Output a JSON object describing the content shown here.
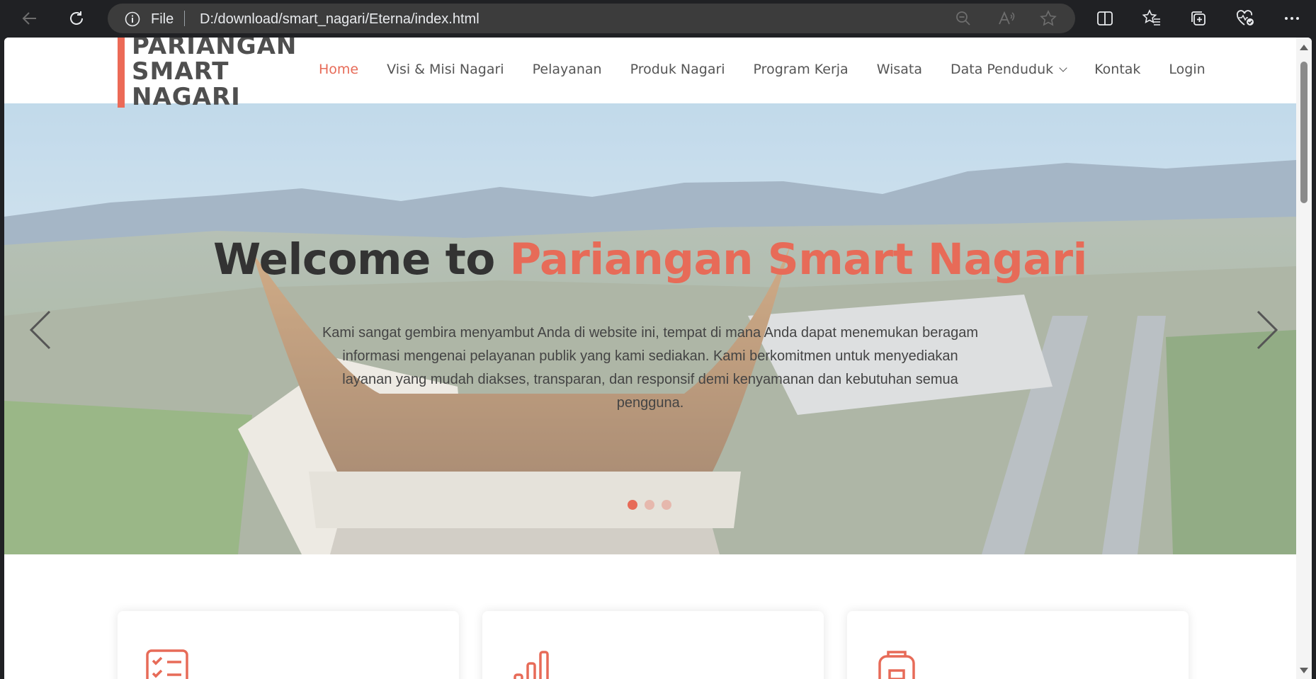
{
  "browser": {
    "scheme": "File",
    "url": "D:/download/smart_nagari/Eterna/index.html",
    "icons": [
      "back-icon",
      "refresh-icon",
      "info-icon",
      "zoom-out-icon",
      "read-aloud-icon",
      "star-icon",
      "split-screen-icon",
      "favorites-icon",
      "collections-icon",
      "browser-essentials-icon",
      "more-icon"
    ]
  },
  "site": {
    "logo_line1": "PARIANGAN",
    "logo_line2": "SMART",
    "logo_line3": "NAGARI",
    "nav": [
      {
        "label": "Home",
        "active": true
      },
      {
        "label": "Visi & Misi Nagari"
      },
      {
        "label": "Pelayanan"
      },
      {
        "label": "Produk Nagari"
      },
      {
        "label": "Program Kerja"
      },
      {
        "label": "Wisata"
      },
      {
        "label": "Data Penduduk",
        "dropdown": true
      },
      {
        "label": "Kontak"
      },
      {
        "label": "Login"
      }
    ]
  },
  "hero": {
    "title_prefix": "Welcome to",
    "title_accent": "Pariangan Smart Nagari",
    "text": "Kami sangat gembira menyambut Anda di website ini, tempat di mana Anda dapat menemukan beragam informasi mengenai pelayanan publik yang kami sediakan. Kami berkomitmen untuk menyediakan layanan yang mudah diakses, transparan, dan responsif demi kenyamanan dan kebutuhan semua pengguna.",
    "slides": 3,
    "active_slide": 1
  },
  "colors": {
    "accent": "#e76b58",
    "text": "#333333"
  },
  "cards": [
    {
      "icon": "checklist-icon"
    },
    {
      "icon": "bar-chart-icon"
    },
    {
      "icon": "backpack-icon"
    }
  ]
}
